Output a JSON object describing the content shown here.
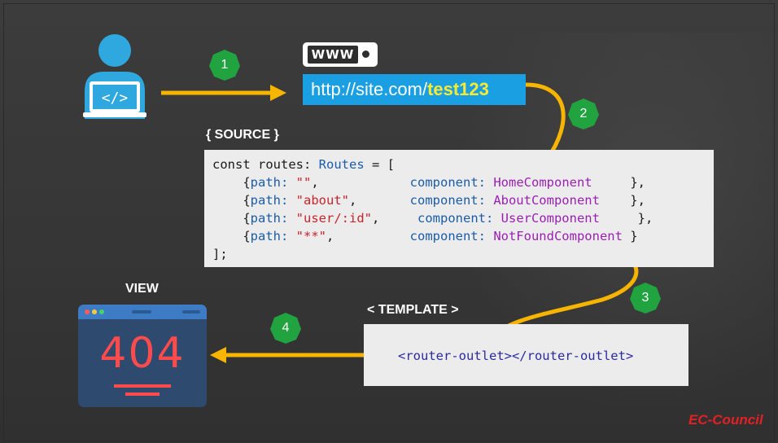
{
  "steps": [
    "1",
    "2",
    "3",
    "4"
  ],
  "www_label": "WWW",
  "url": {
    "prefix": "http://site.com/",
    "highlight": "test123"
  },
  "source_label": "{ SOURCE }",
  "code": {
    "line1": {
      "kw": "const",
      "name": " routes: ",
      "type": "Routes",
      "rest": " = ["
    },
    "routes": [
      {
        "open": "    {",
        "key": "path: ",
        "path": "\"\"",
        "mid": ",            ",
        "ckey": "component: ",
        "comp": "HomeComponent",
        "close": "     },"
      },
      {
        "open": "    {",
        "key": "path: ",
        "path": "\"about\"",
        "mid": ",       ",
        "ckey": "component: ",
        "comp": "AboutComponent",
        "close": "    },"
      },
      {
        "open": "    {",
        "key": "path: ",
        "path": "\"user/:id\"",
        "mid": ",     ",
        "ckey": "component: ",
        "comp": "UserComponent",
        "close": "     },"
      },
      {
        "open": "    {",
        "key": "path: ",
        "path": "\"**\"",
        "mid": ",          ",
        "ckey": "component: ",
        "comp": "NotFoundComponent",
        "close": " }"
      }
    ],
    "last": "];"
  },
  "template_label": "< TEMPLATE >",
  "template_code": "<router-outlet></router-outlet>",
  "view_label": "VIEW",
  "view_text": "404",
  "brand": "EC-Council",
  "colors": {
    "arrow": "#f7b500",
    "badge": "#21a33f",
    "user": "#2fa8e0",
    "url_bg": "#1aa0e2",
    "url_highlight": "#f8ea32",
    "error": "#ff4b4b"
  }
}
